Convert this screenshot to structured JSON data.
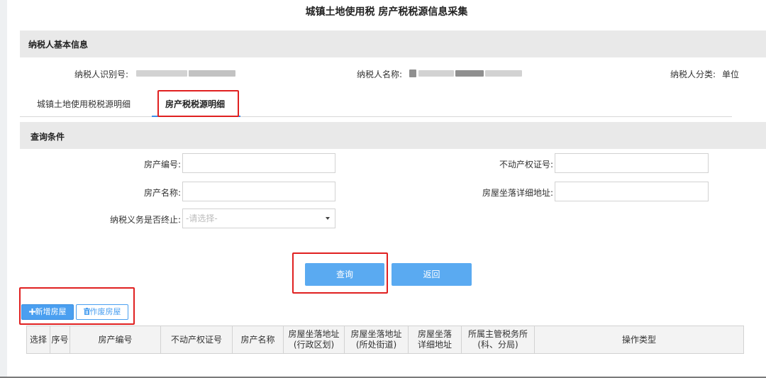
{
  "header": {
    "title": "城镇土地使用税  房产税税源信息采集"
  },
  "basic_info": {
    "section_title": "纳税人基本信息",
    "taxpayer_id_label": "纳税人识别号:",
    "taxpayer_name_label": "纳税人名称:",
    "taxpayer_category_label": "纳税人分类:",
    "taxpayer_category_value": "单位"
  },
  "tabs": [
    {
      "label": "城镇土地使用税税源明细",
      "active": false
    },
    {
      "label": "房产税税源明细",
      "active": true
    }
  ],
  "query": {
    "section_title": "查询条件",
    "fields": {
      "property_no": {
        "label": "房产编号:",
        "value": ""
      },
      "cert_no": {
        "label": "不动产权证号:",
        "value": ""
      },
      "property_name": {
        "label": "房产名称:",
        "value": ""
      },
      "address_detail": {
        "label": "房屋坐落详细地址:",
        "value": ""
      },
      "terminated": {
        "label": "纳税义务是否终止:",
        "placeholder": "-请选择-"
      }
    },
    "search_label": "查询",
    "back_label": "返回"
  },
  "toolbar": {
    "add_icon": "plus-icon",
    "add_label": "新增房屋",
    "void_icon": "trash-icon",
    "void_label": "作废房屋"
  },
  "table": {
    "columns": [
      {
        "line1": "选择",
        "line2": ""
      },
      {
        "line1": "序号",
        "line2": ""
      },
      {
        "line1": "房产编号",
        "line2": ""
      },
      {
        "line1": "不动产权证号",
        "line2": ""
      },
      {
        "line1": "房产名称",
        "line2": ""
      },
      {
        "line1": "房屋坐落地址",
        "line2": "(行政区划)"
      },
      {
        "line1": "房屋坐落地址",
        "line2": "(所处街道)"
      },
      {
        "line1": "房屋坐落",
        "line2": "详细地址"
      },
      {
        "line1": "所属主管税务所",
        "line2": "(科、分局)"
      },
      {
        "line1": "操作类型",
        "line2": ""
      }
    ]
  },
  "colors": {
    "primary_button": "#5aaaf1",
    "highlight_box": "#e02020",
    "tab_underline": "#3d8ee8"
  }
}
